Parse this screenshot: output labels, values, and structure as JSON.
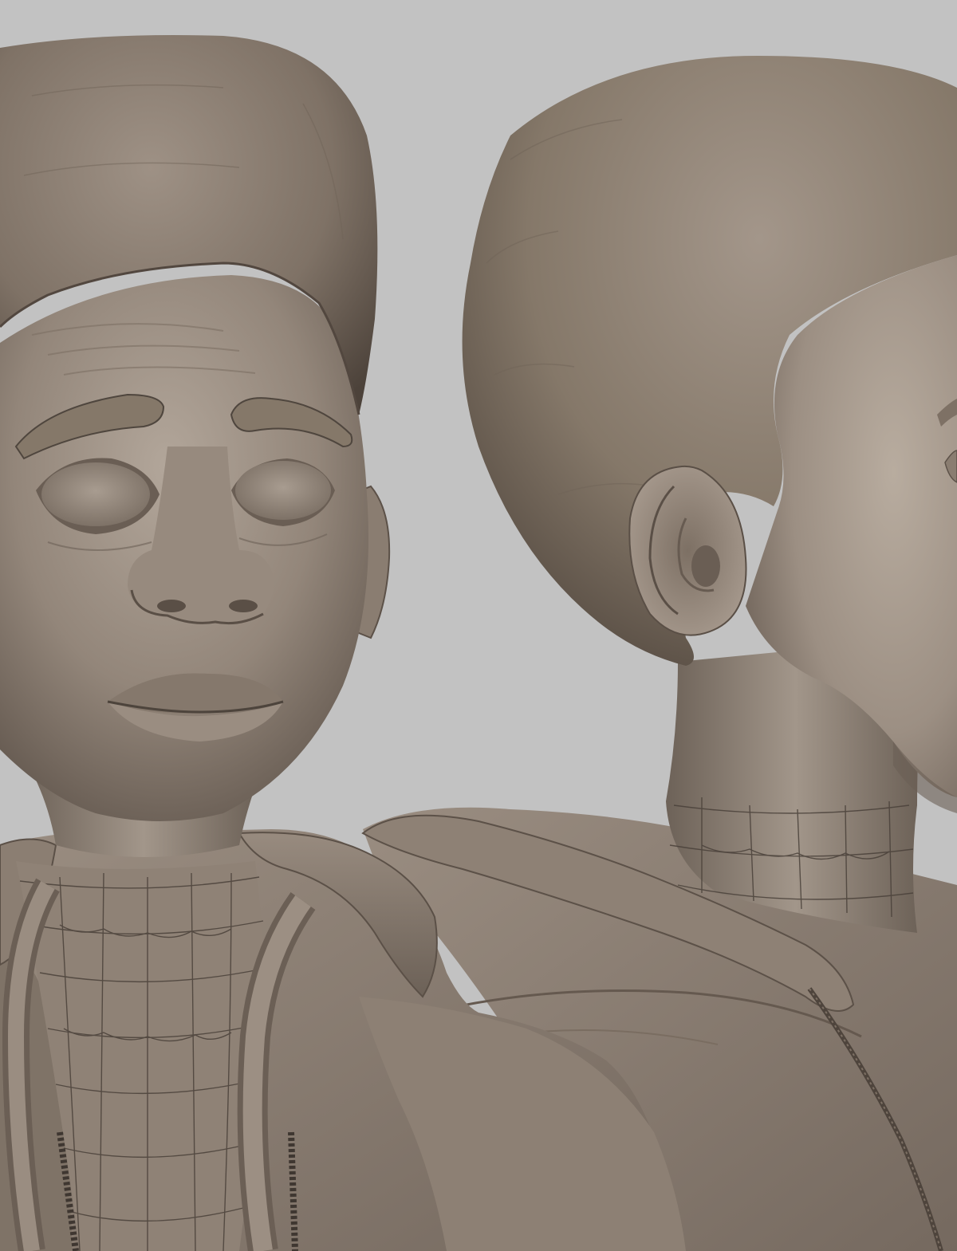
{
  "scene": {
    "background_color": "#c2c2c2",
    "clay_light": "#a69a8e",
    "clay_mid": "#8a7d71",
    "clay_dark": "#5c5148",
    "clay_shadow": "#3e3631",
    "line_color": "#4a413a"
  },
  "views": [
    {
      "name": "front-view",
      "subject": "sculpted-bust-front"
    },
    {
      "name": "side-view",
      "subject": "sculpted-bust-profile"
    }
  ]
}
